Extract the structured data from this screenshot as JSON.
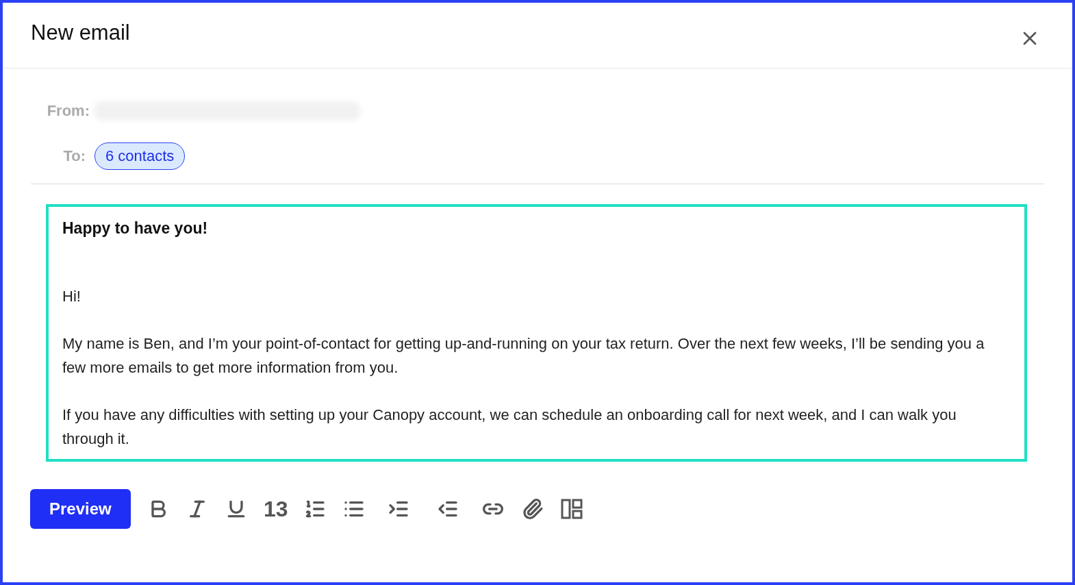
{
  "window": {
    "title": "New email"
  },
  "fields": [
    {
      "kind": "redacted",
      "label": "From:"
    },
    {
      "kind": "chips",
      "label": "To:",
      "chips": [
        "6 contacts"
      ]
    }
  ],
  "editor": {
    "focused": true,
    "blocks": [
      {
        "kind": "heading",
        "text": "Happy to have you!"
      },
      {
        "kind": "paragraph",
        "text": "Hi!"
      },
      {
        "kind": "paragraph",
        "text": "My name is Ben, and I’m your point-of-contact for getting up-and-running on your tax return. Over the next few weeks, I’ll be sending you a few more emails to get more information from you."
      },
      {
        "kind": "paragraph",
        "text": "If you have any difficulties with setting up your Canopy account, we can schedule an onboarding call for next week, and I can walk you through it."
      }
    ]
  },
  "toolbar": {
    "primary": "Preview",
    "tools": [
      {
        "kind": "bold"
      },
      {
        "kind": "italic"
      },
      {
        "kind": "underline"
      },
      {
        "kind": "size",
        "text": "13"
      },
      {
        "kind": "numbered-list"
      },
      {
        "kind": "bullet-list"
      },
      {
        "kind": "indent"
      },
      {
        "kind": "outdent"
      },
      {
        "kind": "link"
      },
      {
        "kind": "attach"
      },
      {
        "kind": "layout"
      }
    ]
  }
}
